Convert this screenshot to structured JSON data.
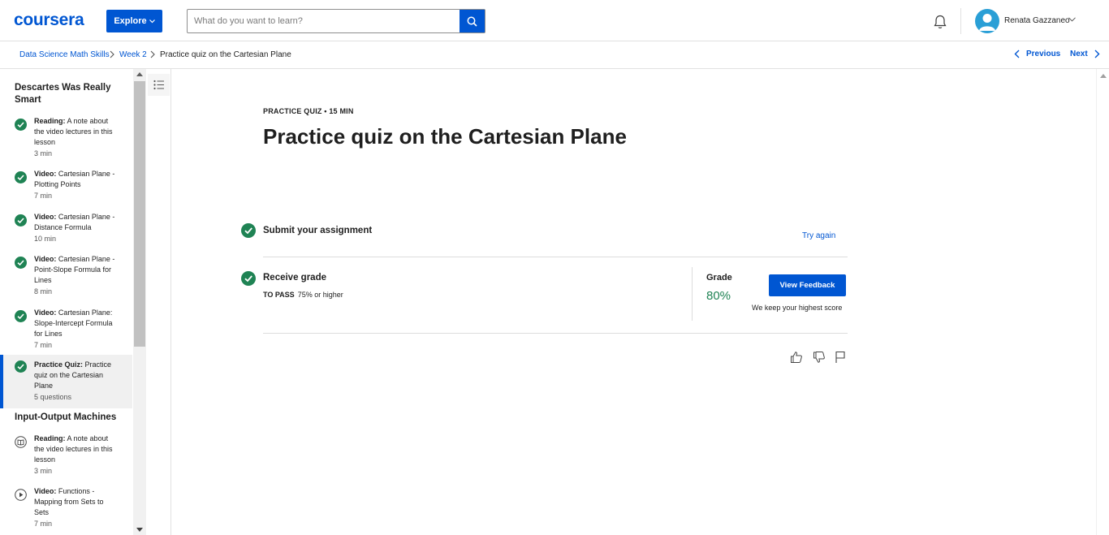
{
  "header": {
    "logo": "coursera",
    "explore_label": "Explore",
    "search_placeholder": "What do you want to learn?",
    "user_name": "Renata Gazzaneo"
  },
  "breadcrumb": {
    "items": [
      "Data Science Math Skills",
      "Week 2",
      "Practice quiz on the Cartesian Plane"
    ],
    "previous_label": "Previous",
    "next_label": "Next"
  },
  "sidebar": {
    "section1_title": "Descartes Was Really Smart",
    "section1_items": [
      {
        "type": "Reading:",
        "title": "A note about the video lectures in this lesson",
        "duration": "3 min",
        "status": "completed"
      },
      {
        "type": "Video:",
        "title": "Cartesian Plane - Plotting Points",
        "duration": "7 min",
        "status": "completed"
      },
      {
        "type": "Video:",
        "title": "Cartesian Plane - Distance Formula",
        "duration": "10 min",
        "status": "completed"
      },
      {
        "type": "Video:",
        "title": "Cartesian Plane - Point-Slope Formula for Lines",
        "duration": "8 min",
        "status": "completed"
      },
      {
        "type": "Video:",
        "title": "Cartesian Plane: Slope-Intercept Formula for Lines",
        "duration": "7 min",
        "status": "completed"
      },
      {
        "type": "Practice Quiz:",
        "title": "Practice quiz on the Cartesian Plane",
        "duration": "5 questions",
        "status": "completed"
      }
    ],
    "section2_title": "Input-Output Machines",
    "section2_items": [
      {
        "type": "Reading:",
        "title": "A note about the video lectures in this lesson",
        "duration": "3 min",
        "status": "book"
      },
      {
        "type": "Video:",
        "title": "Functions - Mapping from Sets to Sets",
        "duration": "7 min",
        "status": "play"
      }
    ]
  },
  "main": {
    "eyebrow": "PRACTICE QUIZ • 15 MIN",
    "title": "Practice quiz on the Cartesian Plane",
    "submit_label": "Submit your assignment",
    "try_again_label": "Try again",
    "receive_grade_label": "Receive grade",
    "to_pass_label": "TO PASS",
    "to_pass_value": "75% or higher",
    "grade_label": "Grade",
    "grade_value": "80%",
    "view_feedback_label": "View Feedback",
    "keep_score_note": "We keep your highest score"
  },
  "colors": {
    "brand": "#0056d2",
    "success": "#1f8354",
    "active_bg": "#f0f0f0"
  }
}
